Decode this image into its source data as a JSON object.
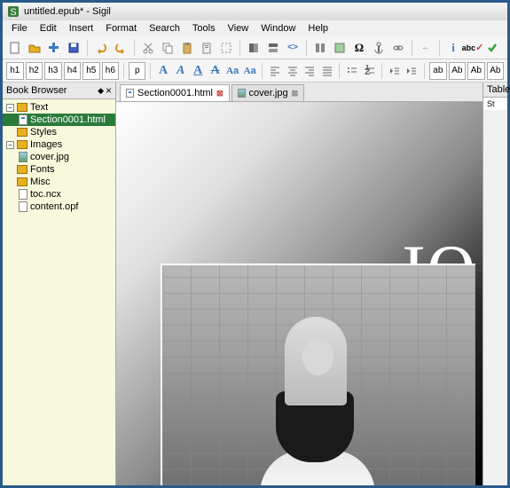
{
  "window": {
    "title": "untitled.epub* - Sigil"
  },
  "menu": [
    "File",
    "Edit",
    "Insert",
    "Format",
    "Search",
    "Tools",
    "View",
    "Window",
    "Help"
  ],
  "toolbar1_icons": [
    "new",
    "open",
    "add",
    "save",
    "undo",
    "redo",
    "cut",
    "copy",
    "paste",
    "clipboard",
    "select",
    "bookview",
    "splitview",
    "codeview",
    "preview",
    "inspect",
    "insert-img",
    "embed",
    "toc",
    "anchor",
    "link",
    "back",
    "fwd",
    "metadata",
    "spellcheck",
    "validate"
  ],
  "toolbar2_headings": [
    "h1",
    "h2",
    "h3",
    "h4",
    "h5",
    "h6"
  ],
  "toolbar2_p": "p",
  "toolbar2_format": [
    "bold",
    "italic",
    "underline",
    "strike",
    "sub",
    "sup",
    "color",
    "align-left",
    "align-center",
    "align-right",
    "align-justify",
    "list-ul",
    "list-ol",
    "indent-out",
    "indent-in",
    "lowercase",
    "uppercase",
    "titlecase",
    "smallcaps"
  ],
  "sidebar": {
    "title": "Book Browser",
    "close": "×"
  },
  "tree": [
    {
      "name": "Text",
      "type": "folder",
      "level": 1,
      "expanded": true
    },
    {
      "name": "Section0001.html",
      "type": "html",
      "level": 2,
      "selected": true
    },
    {
      "name": "Styles",
      "type": "folder",
      "level": 1
    },
    {
      "name": "Images",
      "type": "folder",
      "level": 1,
      "expanded": true
    },
    {
      "name": "cover.jpg",
      "type": "img",
      "level": 2
    },
    {
      "name": "Fonts",
      "type": "folder",
      "level": 1
    },
    {
      "name": "Misc",
      "type": "folder",
      "level": 1
    },
    {
      "name": "toc.ncx",
      "type": "file",
      "level": 2
    },
    {
      "name": "content.opf",
      "type": "file",
      "level": 2
    }
  ],
  "tabs": [
    {
      "label": "Section0001.html",
      "icon": "html",
      "active": true
    },
    {
      "label": "cover.jpg",
      "icon": "img",
      "active": false
    }
  ],
  "rightpanel": {
    "title": "Table",
    "sub": "St"
  },
  "content": {
    "letter": "Ю"
  }
}
